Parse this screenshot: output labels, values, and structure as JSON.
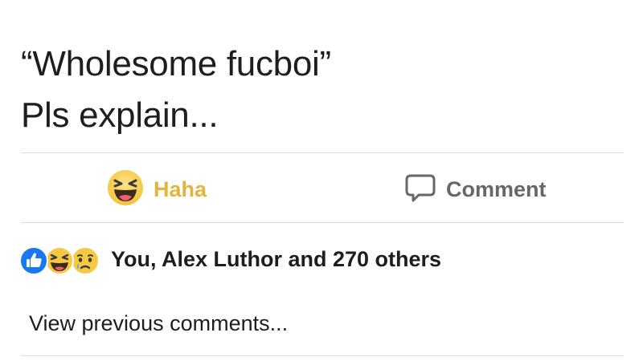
{
  "post": {
    "text_lines": [
      "“Wholesome fucboi”",
      "Pls explain..."
    ]
  },
  "actions": {
    "haha_label": "Haha",
    "comment_label": "Comment"
  },
  "reactions": {
    "summary": "You, Alex Luthor and 270 others",
    "icons": [
      "like-icon",
      "haha-icon",
      "sad-icon"
    ]
  },
  "comments": {
    "view_previous": "View previous comments..."
  },
  "colors": {
    "haha_accent": "#e2b53c",
    "like_blue": "#1877f2",
    "muted_gray": "#65676b",
    "divider": "#dadde1"
  }
}
